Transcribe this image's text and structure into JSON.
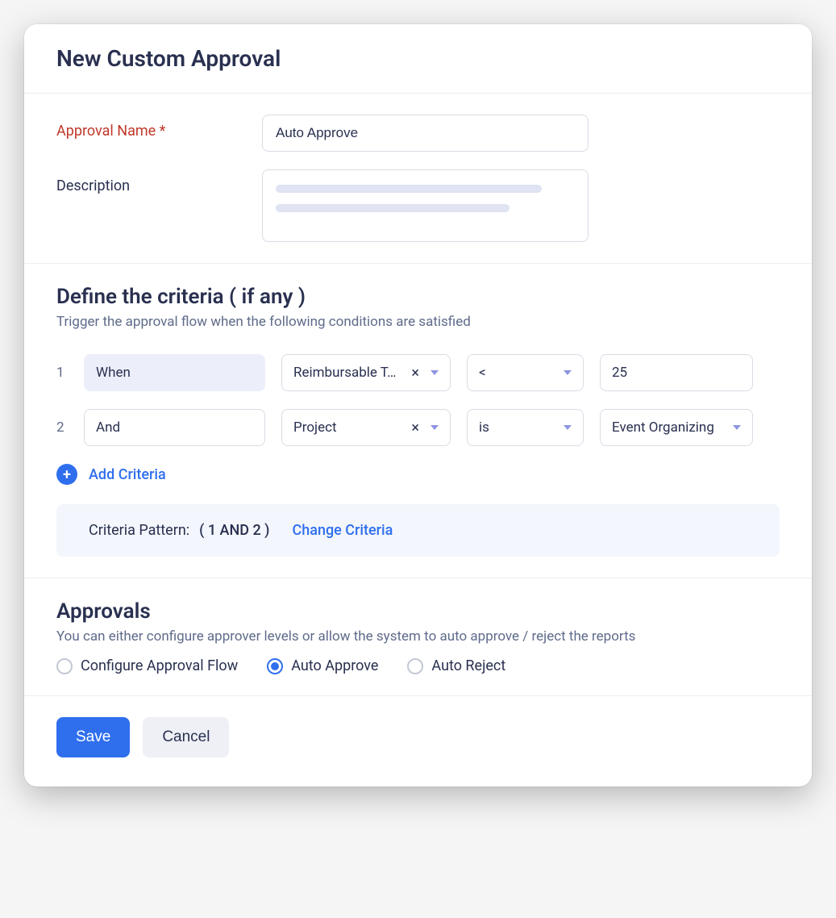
{
  "header": {
    "title": "New Custom Approval"
  },
  "form": {
    "name_label": "Approval Name *",
    "name_value": "Auto Approve",
    "description_label": "Description"
  },
  "criteria": {
    "title": "Define the criteria ( if any )",
    "subtitle": "Trigger the approval flow when the following conditions are satisfied",
    "rows": [
      {
        "num": "1",
        "clause": "When",
        "field": "Reimbursable T…",
        "op": "<",
        "value": "25",
        "clause_readonly": true,
        "value_has_caret": false
      },
      {
        "num": "2",
        "clause": "And",
        "field": "Project",
        "op": "is",
        "value": "Event Organizing",
        "clause_readonly": false,
        "value_has_caret": true
      }
    ],
    "add_label": "Add Criteria",
    "pattern_label": "Criteria Pattern:",
    "pattern_expr": "( 1 AND 2 )",
    "change_label": "Change Criteria"
  },
  "approvals": {
    "title": "Approvals",
    "subtitle": "You can either configure approver levels  or allow the system to auto approve / reject the reports",
    "options": [
      {
        "label": "Configure Approval Flow",
        "selected": false
      },
      {
        "label": "Auto Approve",
        "selected": true
      },
      {
        "label": "Auto Reject",
        "selected": false
      }
    ]
  },
  "footer": {
    "save_label": "Save",
    "cancel_label": "Cancel"
  }
}
